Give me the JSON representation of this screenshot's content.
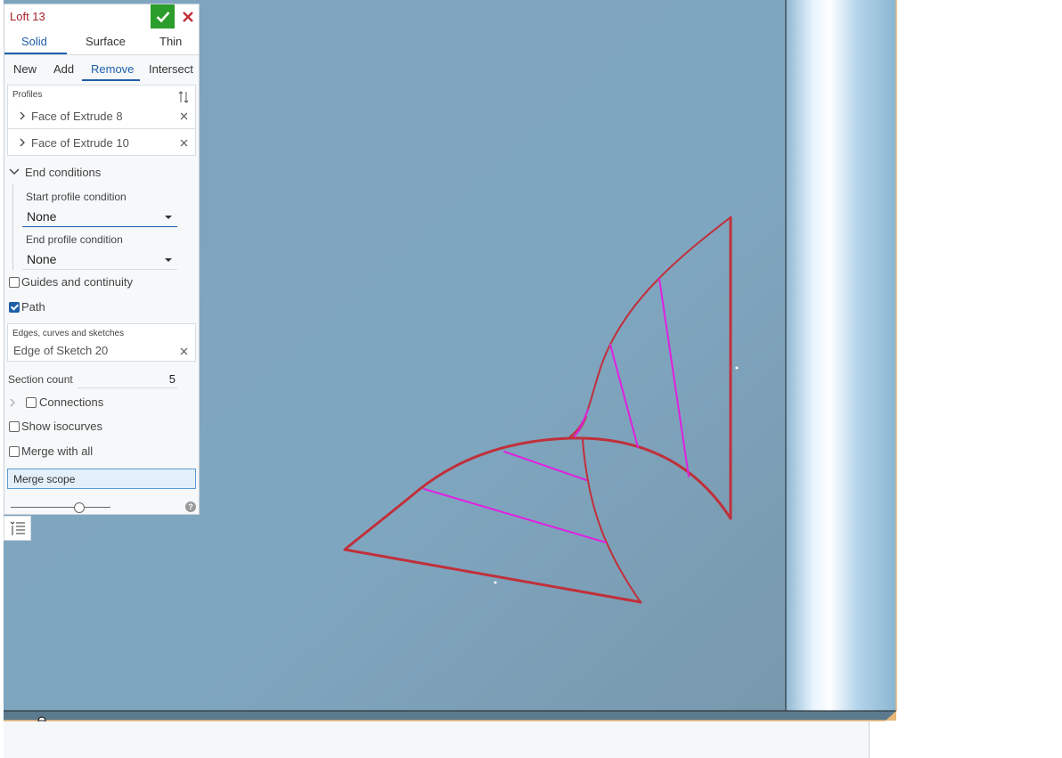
{
  "dialog": {
    "title": "Loft 13",
    "tabs": [
      "Solid",
      "Surface",
      "Thin"
    ],
    "operations": [
      "New",
      "Add",
      "Remove",
      "Intersect"
    ],
    "profiles_label": "Profiles",
    "profiles": [
      "Face of Extrude 8",
      "Face of Extrude 10"
    ],
    "end_conditions": "End conditions",
    "start_profile_condition": "Start profile condition",
    "start_value": "None",
    "end_profile_condition": "End profile condition",
    "end_value": "None",
    "guides": "Guides and continuity",
    "path": "Path",
    "edges_label": "Edges, curves and sketches",
    "edge_item": "Edge of Sketch 20",
    "section_count_label": "Section count",
    "section_count": "5",
    "connections": "Connections",
    "show_isocurves": "Show isocurves",
    "merge_with_all": "Merge with all",
    "merge_scope": "Merge scope",
    "help": "?"
  },
  "icons": {
    "ok": "check-icon",
    "cancel": "close-icon",
    "reorder": "reorder-icon",
    "list": "list-icon"
  },
  "colors": {
    "title": "#a5212a",
    "accent": "#1f5fa8",
    "ok": "#2a9d2a",
    "edge": "#c0303a",
    "isocurve": "#e020e0",
    "background": "#7fa6c0"
  }
}
